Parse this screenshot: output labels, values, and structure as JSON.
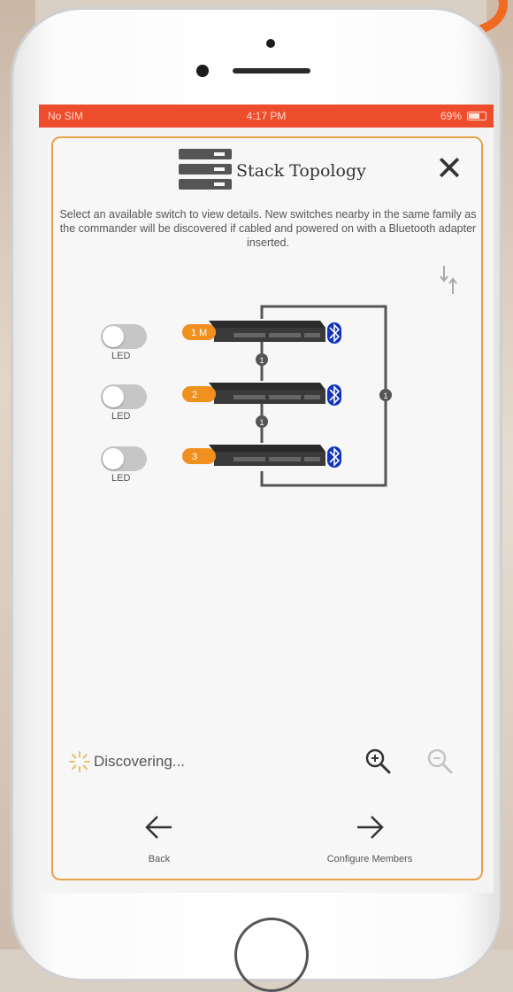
{
  "status_bar": {
    "carrier": "No SIM",
    "time": "4:17 PM",
    "battery_text": "69%",
    "battery_level": 0.69
  },
  "dialog": {
    "title": "Stack Topology",
    "close_icon": "close-icon",
    "description": "Select an available switch to view details. New switches nearby in the same family as the commander will be discovered if cabled and powered on with a Bluetooth adapter inserted.",
    "sort_icon": "sort-arrows-icon"
  },
  "members": [
    {
      "led_label": "LED",
      "badge": "1 M",
      "led_on": false
    },
    {
      "led_label": "LED",
      "badge": "2",
      "led_on": false
    },
    {
      "led_label": "LED",
      "badge": "3",
      "led_on": false
    }
  ],
  "links": [
    "1",
    "1",
    "1"
  ],
  "footer": {
    "discovering_text": "Discovering...",
    "zoom_in_icon": "zoom-in-icon",
    "zoom_out_icon": "zoom-out-icon",
    "back_label": "Back",
    "configure_label": "Configure Members"
  },
  "colors": {
    "status_bar": "#ee4d2d",
    "dialog_border": "#e8a24b",
    "badge": "#f0901f",
    "bluetooth": "#1133bb",
    "switch_body": "#3a3a3a"
  }
}
